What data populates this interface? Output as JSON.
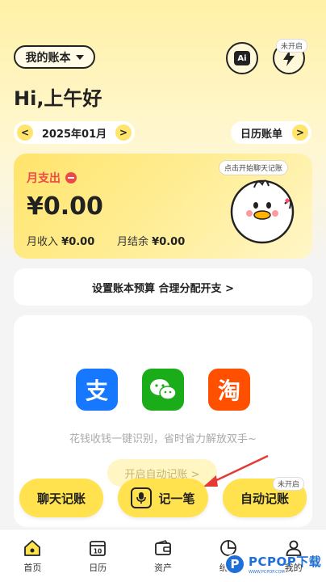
{
  "header": {
    "book_selector": "我的账本",
    "ai_label": "Ai",
    "auto_status_badge": "未开启",
    "greeting": "Hi,上午好"
  },
  "month_nav": {
    "prev": "<",
    "month": "2025年01月",
    "next": ">",
    "calendar_bill": "日历账单",
    "calendar_arrow": ">"
  },
  "stats": {
    "expense_label": "月支出",
    "expense_amount": "¥0.00",
    "income_label": "月收入",
    "income_value": "¥0.00",
    "balance_label": "月结余",
    "balance_value": "¥0.00",
    "bubble_text": "点击开始聊天记账"
  },
  "budget": {
    "text": "设置账本预算 合理分配开支 >"
  },
  "main_card": {
    "apps": [
      {
        "name": "alipay",
        "glyph": "支",
        "color": "#1677ff"
      },
      {
        "name": "wechat",
        "glyph": "",
        "color": "#1aad19"
      },
      {
        "name": "taobao",
        "glyph": "淘",
        "color": "#ff5000"
      }
    ],
    "tagline": "花钱收钱一键识别，省时省力解放双手~",
    "enable_auto": "开启自动记账 >"
  },
  "actions": {
    "chat": "聊天记账",
    "record": "记一笔",
    "auto": "自动记账",
    "auto_badge": "未开启"
  },
  "nav": {
    "items": [
      {
        "label": "首页",
        "icon": "home-icon"
      },
      {
        "label": "日历",
        "icon": "calendar-icon"
      },
      {
        "label": "资产",
        "icon": "wallet-icon"
      },
      {
        "label": "统计",
        "icon": "chart-icon"
      },
      {
        "label": "我的",
        "icon": "user-icon"
      }
    ],
    "calendar_day": "10"
  },
  "watermark": {
    "logo": "P",
    "text": "PCPOP下载",
    "sub": "WWW.PCPOP.COM"
  },
  "colors": {
    "accent_yellow": "#ffe24d",
    "expense_red": "#f04848",
    "arrow_red": "#e53935"
  }
}
